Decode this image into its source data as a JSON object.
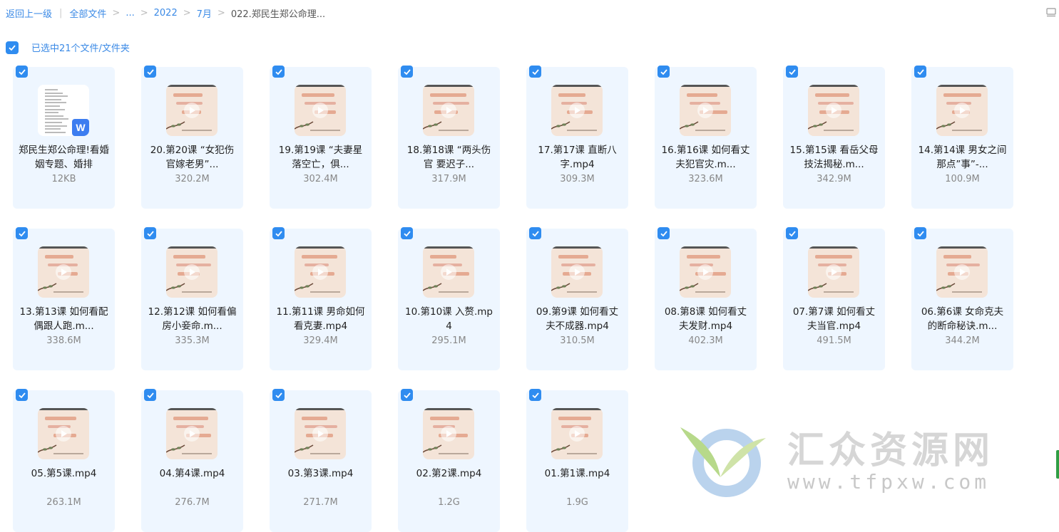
{
  "breadcrumb": {
    "back": "返回上一级",
    "all_files": "全部文件",
    "ellipsis": "...",
    "year": "2022",
    "month": "7月",
    "current": "022.郑民生郑公命理..."
  },
  "selection": {
    "label": "已选中21个文件/文件夹"
  },
  "accent_color": "#2f8cf0",
  "files": [
    {
      "name": "郑民生郑公命理!看婚姻专题、婚排",
      "size": "12KB",
      "type": "doc"
    },
    {
      "name": "20.第20课 “女犯伤官嫁老男”...",
      "size": "320.2M",
      "type": "video"
    },
    {
      "name": "19.第19课 “夫妻星落空亡，俱...",
      "size": "302.4M",
      "type": "video"
    },
    {
      "name": "18.第18课 “两头伤官 要迟子...",
      "size": "317.9M",
      "type": "video"
    },
    {
      "name": "17.第17课 直断八字.mp4",
      "size": "309.3M",
      "type": "video"
    },
    {
      "name": "16.第16课 如何看丈夫犯官灾.m...",
      "size": "323.6M",
      "type": "video"
    },
    {
      "name": "15.第15课 看岳父母技法揭秘.m...",
      "size": "342.9M",
      "type": "video"
    },
    {
      "name": "14.第14课 男女之间那点”事”-...",
      "size": "100.9M",
      "type": "video"
    },
    {
      "name": "13.第13课 如何看配偶跟人跑.m...",
      "size": "338.6M",
      "type": "video"
    },
    {
      "name": "12.第12课 如何看偏房小妾命.m...",
      "size": "335.3M",
      "type": "video"
    },
    {
      "name": "11.第11课 男命如何看克妻.mp4",
      "size": "329.4M",
      "type": "video"
    },
    {
      "name": "10.第10课 入赘.mp4",
      "size": "295.1M",
      "type": "video"
    },
    {
      "name": "09.第9课 如何看丈夫不成器.mp4",
      "size": "310.5M",
      "type": "video"
    },
    {
      "name": "08.第8课 如何看丈夫发财.mp4",
      "size": "402.3M",
      "type": "video"
    },
    {
      "name": "07.第7课 如何看丈夫当官.mp4",
      "size": "491.5M",
      "type": "video"
    },
    {
      "name": "06.第6课 女命克夫的断命秘诀.m...",
      "size": "344.2M",
      "type": "video"
    },
    {
      "name": "05.第5课.mp4",
      "size": "263.1M",
      "type": "video"
    },
    {
      "name": "04.第4课.mp4",
      "size": "276.7M",
      "type": "video"
    },
    {
      "name": "03.第3课.mp4",
      "size": "271.7M",
      "type": "video"
    },
    {
      "name": "02.第2课.mp4",
      "size": "1.2G",
      "type": "video"
    },
    {
      "name": "01.第1课.mp4",
      "size": "1.9G",
      "type": "video"
    }
  ],
  "watermark": {
    "title": "汇众资源网",
    "url": "www.tfpxw.com"
  }
}
